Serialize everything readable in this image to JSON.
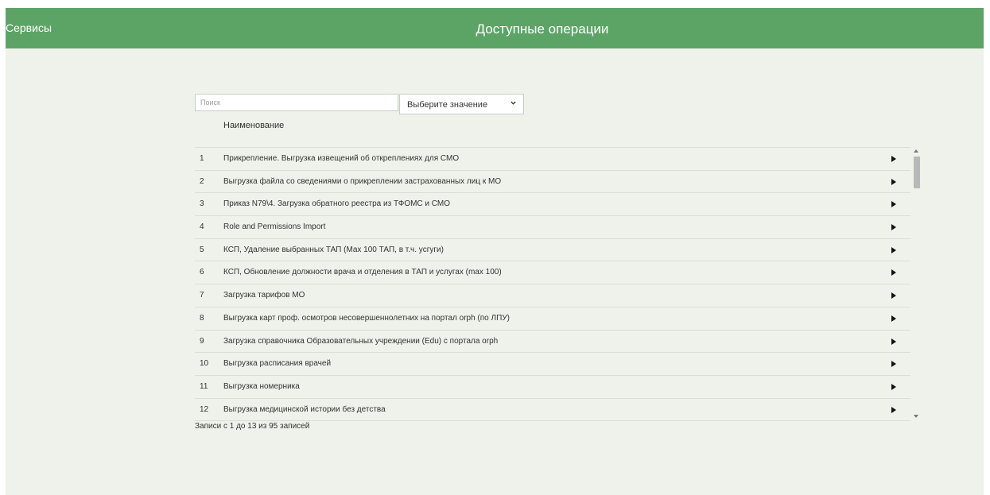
{
  "header": {
    "services_label": "Сервисы",
    "title": "Доступные операции"
  },
  "search": {
    "placeholder": "Поиск",
    "value": ""
  },
  "filter_select": {
    "selected": "Выберите значение"
  },
  "table": {
    "column_header": "Наименование",
    "rows": [
      {
        "num": "1",
        "name": "Прикрепление. Выгрузка извещений об откреплениях для СМО"
      },
      {
        "num": "2",
        "name": "Выгрузка файла со сведениями о прикреплении застрахованных лиц к МО"
      },
      {
        "num": "3",
        "name": "Приказ N79\\4. Загрузка обратного реестра из ТФОМС и СМО"
      },
      {
        "num": "4",
        "name": "Role and Permissions Import"
      },
      {
        "num": "5",
        "name": "КСП, Удаление выбранных ТАП (Max 100 ТАП, в т.ч. усгуги)"
      },
      {
        "num": "6",
        "name": "КСП, Обновление должности врача и отделения в ТАП и услугах (max 100)"
      },
      {
        "num": "7",
        "name": "Загрузка тарифов МО"
      },
      {
        "num": "8",
        "name": "Выгрузка карт проф. осмотров несовершеннолетних на портал orph (по ЛПУ)"
      },
      {
        "num": "9",
        "name": "Загрузка справочника Образовательных учреждении (Edu) с портала orph"
      },
      {
        "num": "10",
        "name": "Выгрузка расписания врачей"
      },
      {
        "num": "11",
        "name": "Выгрузка номерника"
      },
      {
        "num": "12",
        "name": "Выгрузка медицинской истории без детства"
      }
    ]
  },
  "footer": {
    "records_info": "Записи с 1 до 13 из 95 записей"
  },
  "colors": {
    "header_bg": "#5ca466",
    "page_bg": "#eef2ea"
  }
}
